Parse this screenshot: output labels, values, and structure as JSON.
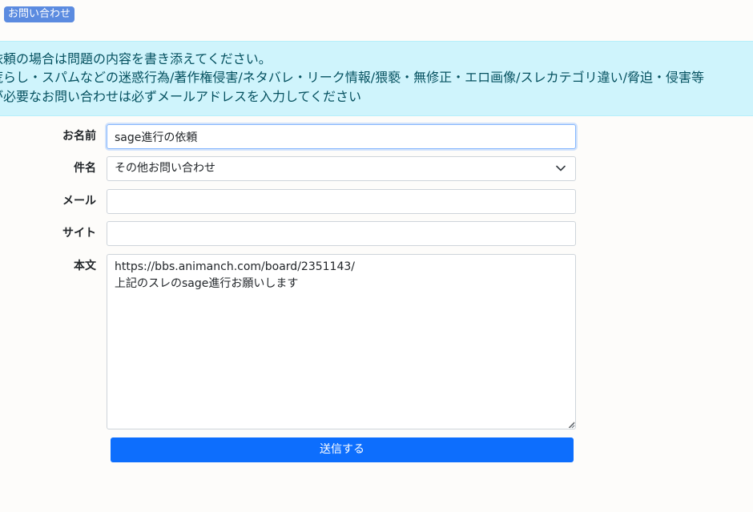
{
  "header": {
    "badge_label": "お問い合わせ"
  },
  "notice": {
    "lines": [
      "依頼の場合は問題の内容を書き添えてください。",
      "荒らし・スパムなどの迷惑行為/著作権侵害/ネタバレ・リーク情報/猥褻・無修正・エロ画像/スレカテゴリ違い/脅迫・侵害等",
      "が必要なお問い合わせは必ずメールアドレスを入力してください"
    ]
  },
  "form": {
    "name": {
      "label": "お名前",
      "value": "sage進行の依頼"
    },
    "subject": {
      "label": "件名",
      "selected": "その他お問い合わせ"
    },
    "email": {
      "label": "メール",
      "value": ""
    },
    "site": {
      "label": "サイト",
      "value": ""
    },
    "body": {
      "label": "本文",
      "value": "https://bbs.animanch.com/board/2351143/\n上記のスレのsage進行お願いします"
    },
    "submit_label": "送信する"
  }
}
